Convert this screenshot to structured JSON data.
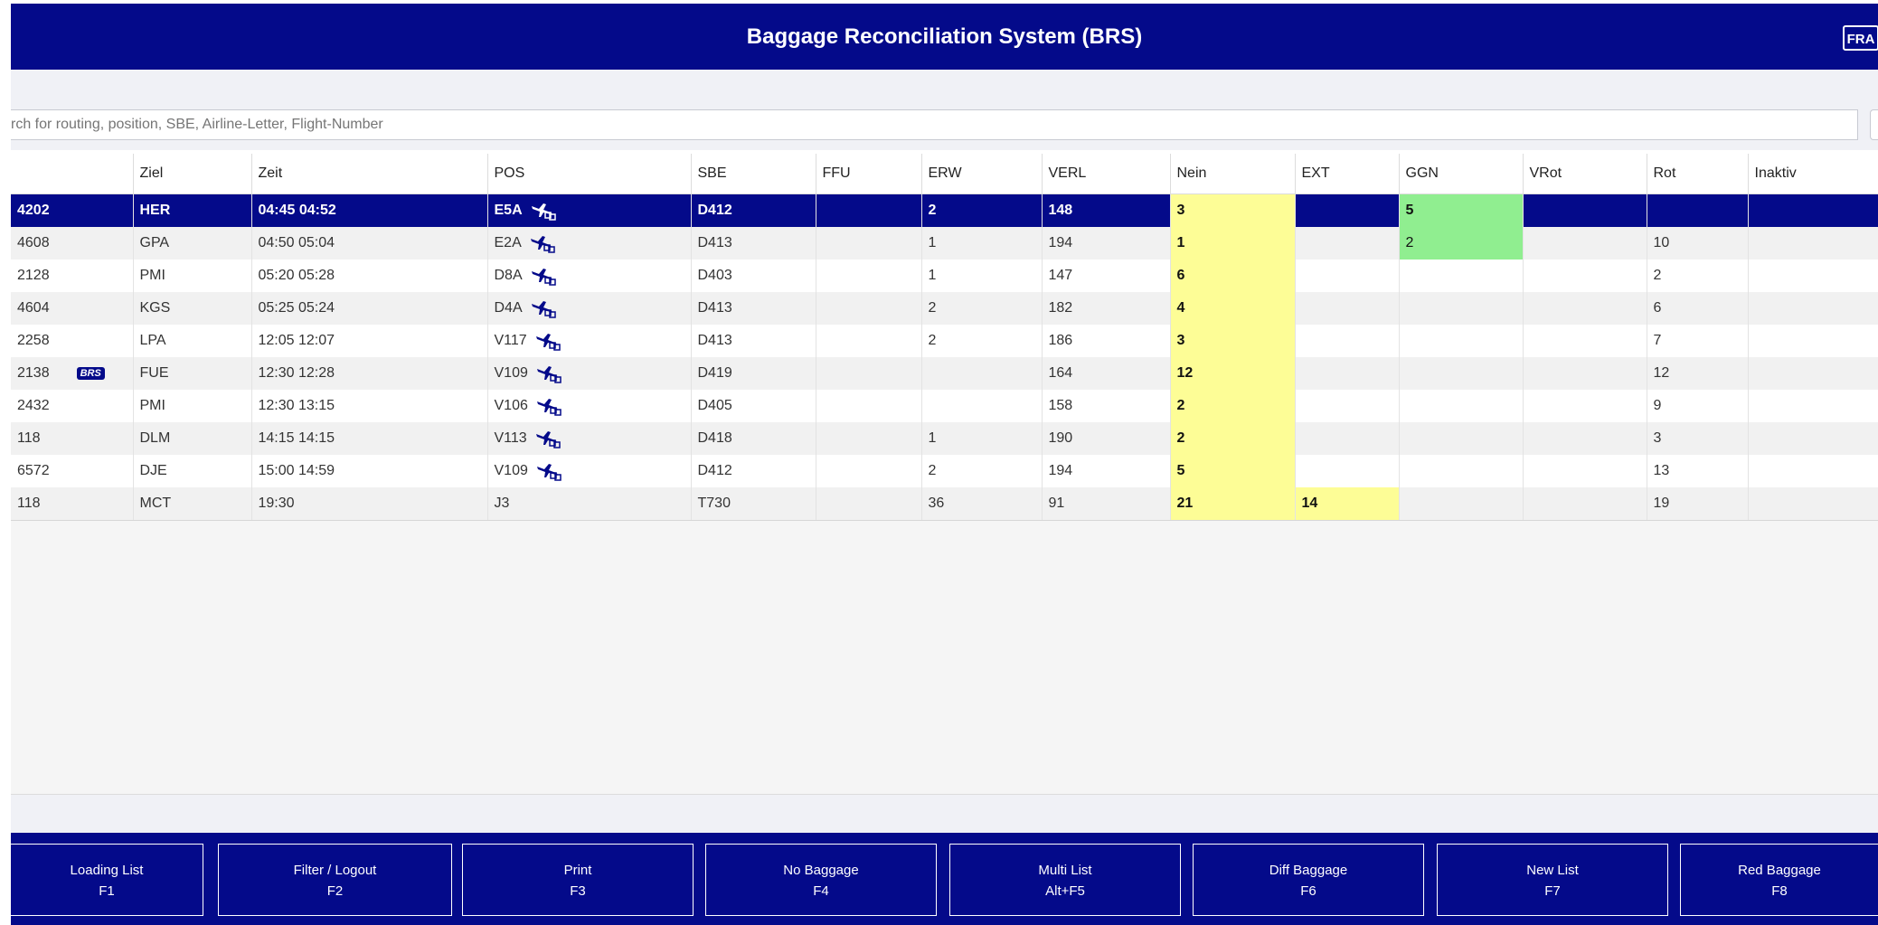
{
  "header": {
    "title": "Baggage Reconciliation System (BRS)",
    "station": "FRA"
  },
  "search": {
    "placeholder": "rch for routing, position, SBE, Airline-Letter, Flight-Number"
  },
  "table": {
    "columns": [
      "",
      "Ziel",
      "Zeit",
      "POS",
      "SBE",
      "FFU",
      "ERW",
      "VERL",
      "Nein",
      "EXT",
      "GGN",
      "VRot",
      "Rot",
      "Inaktiv"
    ],
    "rows": [
      {
        "flight": "4202",
        "ziel": "HER",
        "zeit": "04:45 04:52",
        "pos": "E5A",
        "pos_icon": "loading-aircraft-icon",
        "sbe": "D412",
        "ffu": "",
        "erw": "2",
        "verl": "148",
        "nein": "3",
        "ext": "",
        "ggn": "5",
        "vrot": "",
        "rot": "",
        "inaktiv": "",
        "selected": true
      },
      {
        "flight": "4608",
        "ziel": "GPA",
        "zeit": "04:50 05:04",
        "pos": "E2A",
        "pos_icon": "loading-aircraft-icon",
        "sbe": "D413",
        "ffu": "",
        "erw": "1",
        "verl": "194",
        "nein": "1",
        "ext": "",
        "ggn": "2",
        "vrot": "",
        "rot": "10",
        "inaktiv": ""
      },
      {
        "flight": "2128",
        "ziel": "PMI",
        "zeit": "05:20 05:28",
        "pos": "D8A",
        "pos_icon": "loading-aircraft-icon",
        "sbe": "D403",
        "ffu": "",
        "erw": "1",
        "verl": "147",
        "nein": "6",
        "ext": "",
        "ggn": "",
        "vrot": "",
        "rot": "2",
        "inaktiv": ""
      },
      {
        "flight": "4604",
        "ziel": "KGS",
        "zeit": "05:25 05:24",
        "pos": "D4A",
        "pos_icon": "loading-aircraft-icon",
        "sbe": "D413",
        "ffu": "",
        "erw": "2",
        "verl": "182",
        "nein": "4",
        "ext": "",
        "ggn": "",
        "vrot": "",
        "rot": "6",
        "inaktiv": ""
      },
      {
        "flight": "2258",
        "ziel": "LPA",
        "zeit": "12:05 12:07",
        "pos": "V117",
        "pos_icon": "loading-aircraft-icon",
        "sbe": "D413",
        "ffu": "",
        "erw": "2",
        "verl": "186",
        "nein": "3",
        "ext": "",
        "ggn": "",
        "vrot": "",
        "rot": "7",
        "inaktiv": ""
      },
      {
        "flight": "2138",
        "brs_tag": "BRS",
        "ziel": "FUE",
        "zeit": "12:30 12:28",
        "pos": "V109",
        "pos_icon": "loading-aircraft-icon",
        "sbe": "D419",
        "ffu": "",
        "erw": "",
        "verl": "164",
        "nein": "12",
        "ext": "",
        "ggn": "",
        "vrot": "",
        "rot": "12",
        "inaktiv": ""
      },
      {
        "flight": "2432",
        "ziel": "PMI",
        "zeit": "12:30 13:15",
        "pos": "V106",
        "pos_icon": "loading-aircraft-icon",
        "sbe": "D405",
        "ffu": "",
        "erw": "",
        "verl": "158",
        "nein": "2",
        "ext": "",
        "ggn": "",
        "vrot": "",
        "rot": "9",
        "inaktiv": ""
      },
      {
        "flight": "118",
        "ziel": "DLM",
        "zeit": "14:15 14:15",
        "pos": "V113",
        "pos_icon": "loading-aircraft-icon",
        "sbe": "D418",
        "ffu": "",
        "erw": "1",
        "verl": "190",
        "nein": "2",
        "ext": "",
        "ggn": "",
        "vrot": "",
        "rot": "3",
        "inaktiv": ""
      },
      {
        "flight": "6572",
        "ziel": "DJE",
        "zeit": "15:00 14:59",
        "pos": "V109",
        "pos_icon": "loading-aircraft-icon",
        "sbe": "D412",
        "ffu": "",
        "erw": "2",
        "verl": "194",
        "nein": "5",
        "ext": "",
        "ggn": "",
        "vrot": "",
        "rot": "13",
        "inaktiv": ""
      },
      {
        "flight": "118",
        "ziel": "MCT",
        "zeit": "19:30",
        "pos": "J3",
        "pos_icon": "",
        "sbe": "T730",
        "ffu": "",
        "erw": "36",
        "verl": "91",
        "nein": "21",
        "ext": "14",
        "ggn": "",
        "vrot": "",
        "rot": "19",
        "inaktiv": ""
      }
    ]
  },
  "highlight_colors": {
    "nein": "#fdfd96",
    "ext": "#fdfd96",
    "ggn": "#90ee90",
    "selected_row": "#040a8a"
  },
  "function_keys": [
    {
      "label": "Loading List",
      "key": "F1"
    },
    {
      "label": "Filter / Logout",
      "key": "F2"
    },
    {
      "label": "Print",
      "key": "F3"
    },
    {
      "label": "No Baggage",
      "key": "F4"
    },
    {
      "label": "Multi List",
      "key": "Alt+F5"
    },
    {
      "label": "Diff Baggage",
      "key": "F6"
    },
    {
      "label": "New List",
      "key": "F7"
    },
    {
      "label": "Red Baggage",
      "key": "F8"
    }
  ]
}
